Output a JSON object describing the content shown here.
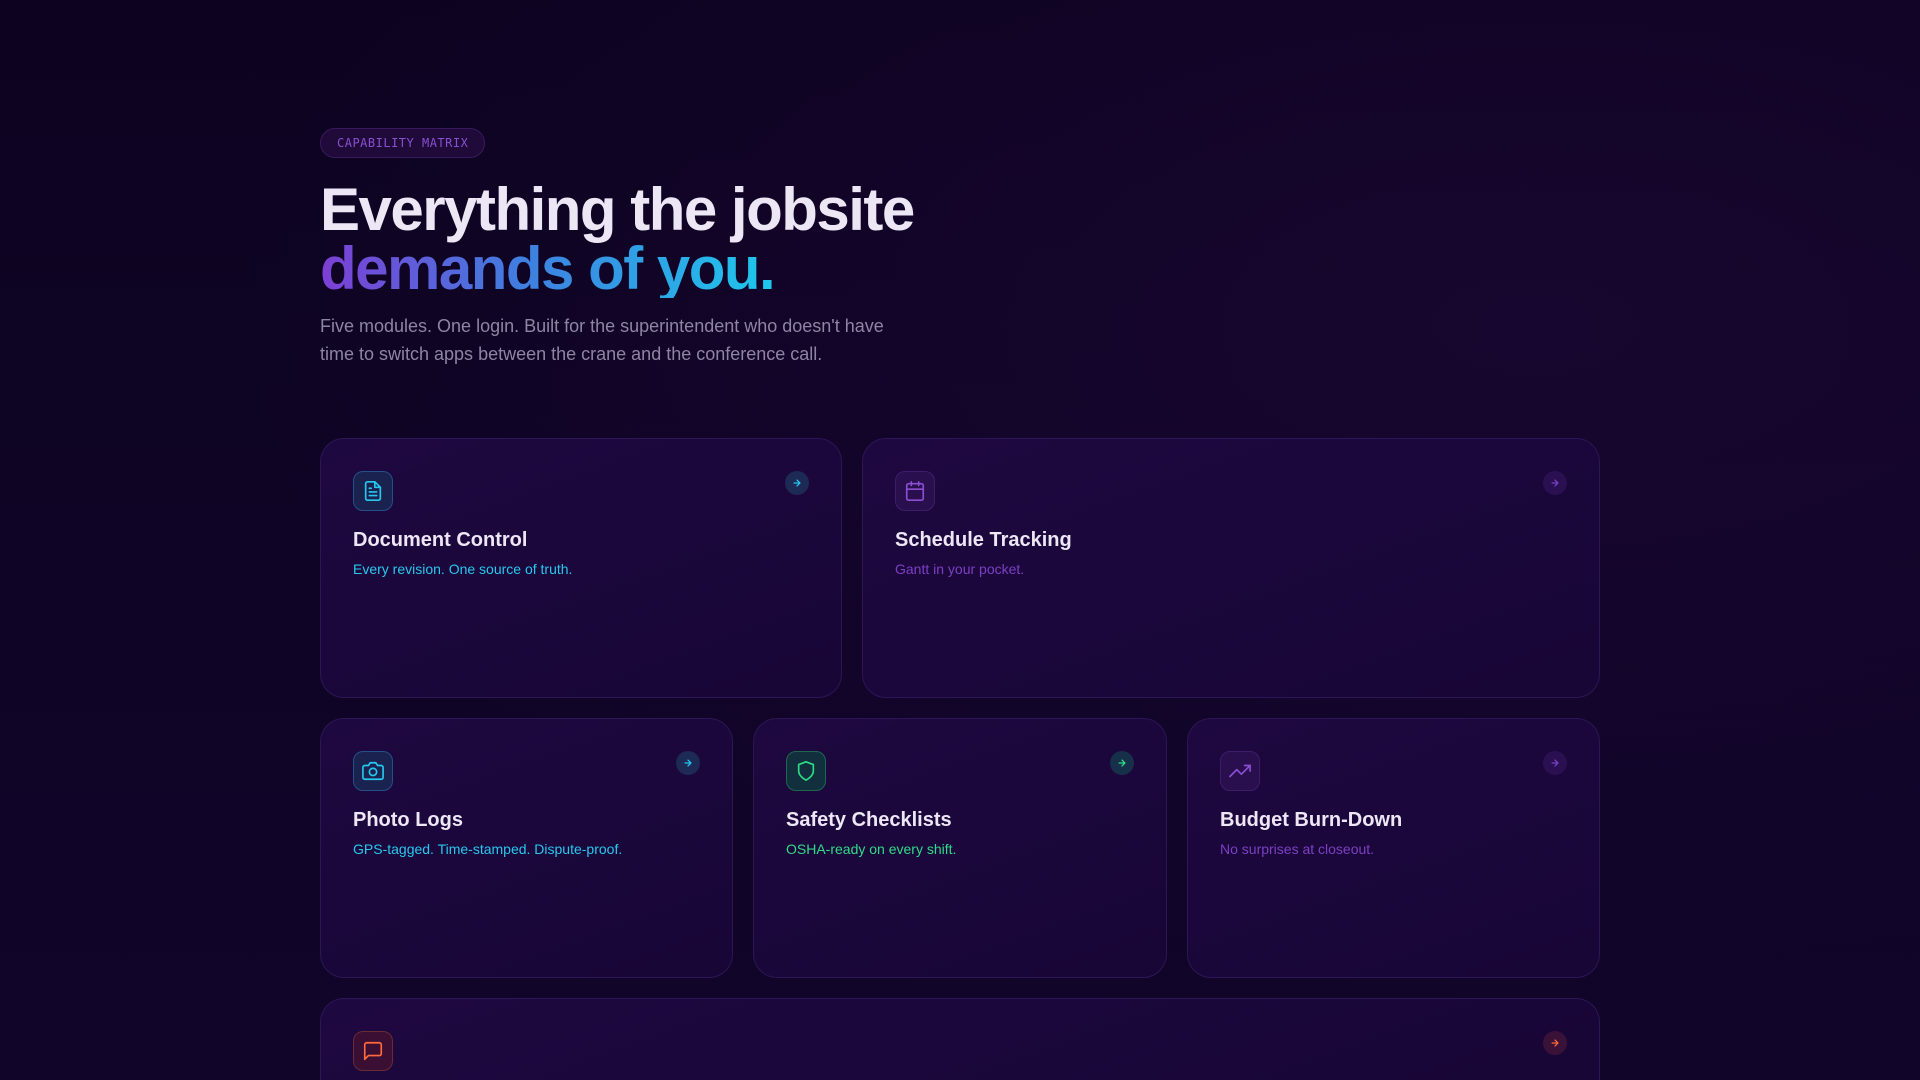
{
  "hero": {
    "eyebrow": "CAPABILITY MATRIX",
    "title_line1": "Everything the jobsite",
    "title_line2": "demands of you.",
    "lead": "Five modules. One login. Built for the superintendent who doesn't have time to switch apps between the crane and the conference call."
  },
  "colors": {
    "background": "#0e0420",
    "card": "#1e0840",
    "cyan": "#27c8ee",
    "violet": "#7c3fc4",
    "green": "#2fdc86",
    "orange": "#ff6a3d"
  },
  "modules": [
    {
      "title": "Document Control",
      "subtitle": "Every revision. One source of truth.",
      "icon": "document-icon",
      "accent": "cyan"
    },
    {
      "title": "Schedule Tracking",
      "subtitle": "Gantt in your pocket.",
      "icon": "calendar-icon",
      "accent": "violet"
    },
    {
      "title": "Photo Logs",
      "subtitle": "GPS-tagged. Time-stamped. Dispute-proof.",
      "icon": "camera-icon",
      "accent": "cyan"
    },
    {
      "title": "Safety Checklists",
      "subtitle": "OSHA-ready on every shift.",
      "icon": "shield-icon",
      "accent": "green"
    },
    {
      "title": "Budget Burn-Down",
      "subtitle": "No surprises at closeout.",
      "icon": "trending-up-icon",
      "accent": "violet"
    },
    {
      "title": "",
      "subtitle": "",
      "icon": "message-icon",
      "accent": "orange"
    }
  ]
}
